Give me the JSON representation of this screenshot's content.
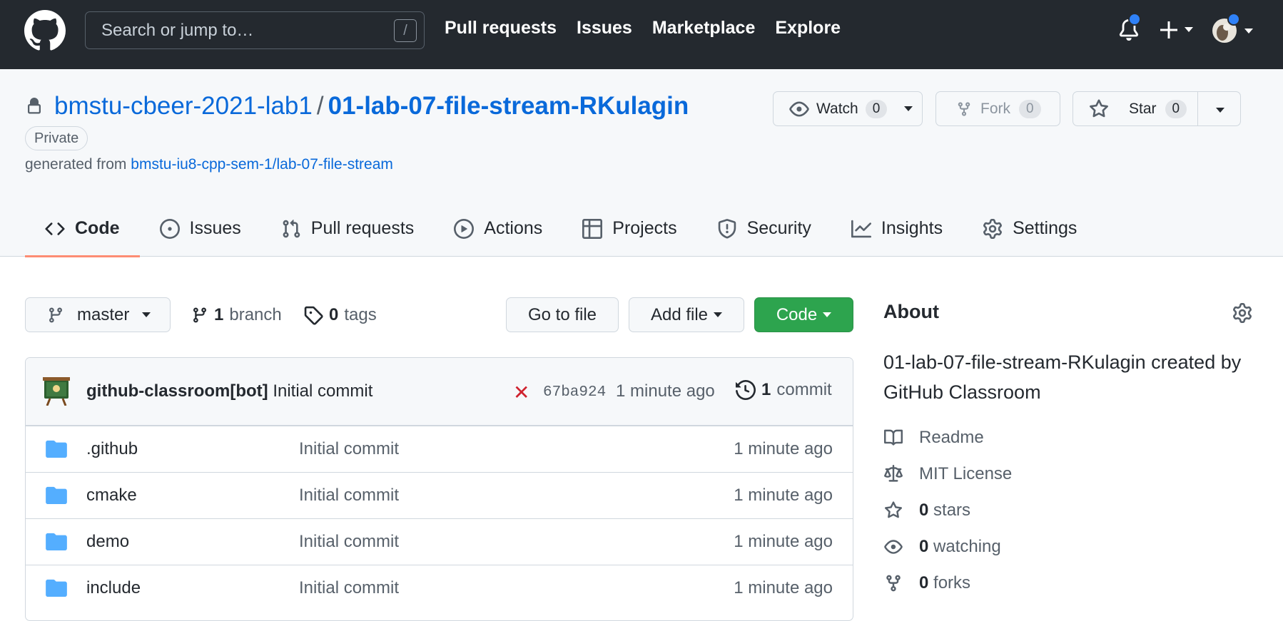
{
  "header": {
    "search_placeholder": "Search or jump to…",
    "search_key": "/",
    "nav": [
      "Pull requests",
      "Issues",
      "Marketplace",
      "Explore"
    ],
    "notification_dot_color": "#2f81f7"
  },
  "repo": {
    "owner": "bmstu-cbeer-2021-lab1",
    "separator": "/",
    "name": "01-lab-07-file-stream-RKulagin",
    "visibility": "Private",
    "generated_prefix": "generated from",
    "template_link": "bmstu-iu8-cpp-sem-1/lab-07-file-stream",
    "watch_label": "Watch",
    "watch_count": "0",
    "fork_label": "Fork",
    "fork_count": "0",
    "star_label": "Star",
    "star_count": "0"
  },
  "tabs": [
    {
      "label": "Code",
      "icon": "code-icon",
      "active": true
    },
    {
      "label": "Issues",
      "icon": "issue-opened-icon"
    },
    {
      "label": "Pull requests",
      "icon": "git-pull-request-icon"
    },
    {
      "label": "Actions",
      "icon": "play-icon"
    },
    {
      "label": "Projects",
      "icon": "table-icon"
    },
    {
      "label": "Security",
      "icon": "shield-icon"
    },
    {
      "label": "Insights",
      "icon": "graph-icon"
    },
    {
      "label": "Settings",
      "icon": "gear-icon"
    }
  ],
  "toolbar": {
    "branch": "master",
    "branch_count": "1",
    "branch_label": "branch",
    "tag_count": "0",
    "tag_label": "tags",
    "go_to_file": "Go to file",
    "add_file": "Add file",
    "code": "Code"
  },
  "latest_commit": {
    "author": "github-classroom[bot]",
    "message": "Initial commit",
    "status": "✕",
    "status_color": "#cf222e",
    "sha": "67ba924",
    "time": "1 minute ago",
    "commit_count": "1",
    "commit_label": "commit"
  },
  "files": [
    {
      "name": ".github",
      "message": "Initial commit",
      "time": "1 minute ago"
    },
    {
      "name": "cmake",
      "message": "Initial commit",
      "time": "1 minute ago"
    },
    {
      "name": "demo",
      "message": "Initial commit",
      "time": "1 minute ago"
    },
    {
      "name": "include",
      "message": "Initial commit",
      "time": "1 minute ago"
    }
  ],
  "about": {
    "title": "About",
    "description": "01-lab-07-file-stream-RKulagin created by GitHub Classroom",
    "readme": "Readme",
    "license": "MIT License",
    "stars_count": "0",
    "stars_label": "stars",
    "watching_count": "0",
    "watching_label": "watching",
    "forks_count": "0",
    "forks_label": "forks"
  }
}
